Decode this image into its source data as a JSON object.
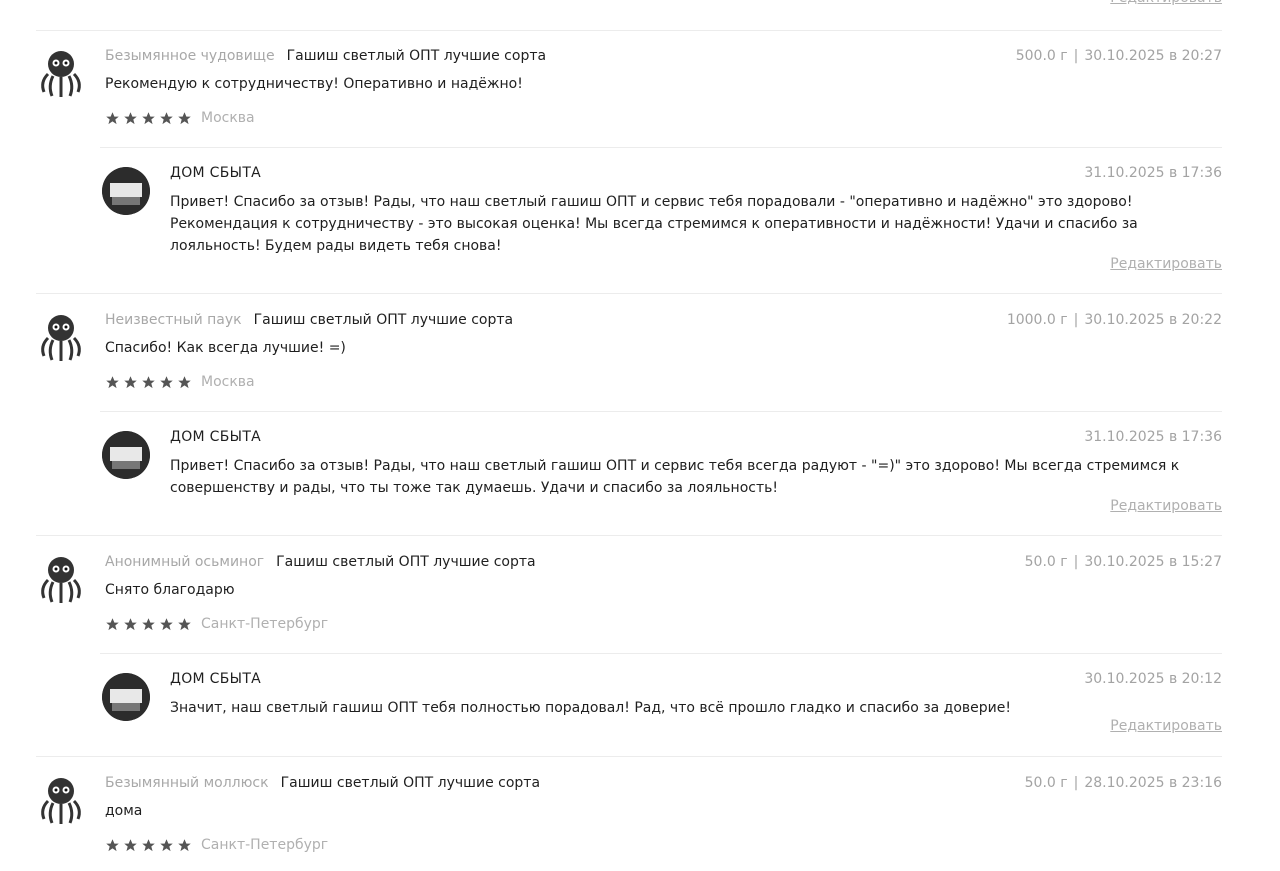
{
  "edit_label": "Редактировать",
  "reviews": [
    {
      "author": "Безымянное чудовище",
      "product": "Гашиш светлый ОПТ лучшие сорта",
      "weight": "500.0 г",
      "date": "30.10.2025 в 20:27",
      "text": "Рекомендую к сотрудничеству! Оперативно и надёжно!",
      "stars": 5,
      "city": "Москва",
      "reply": {
        "author": "ДОМ СБЫТА",
        "date": "31.10.2025 в 17:36",
        "text": "Привет! Спасибо за отзыв! Рады, что наш светлый гашиш ОПТ и сервис тебя порадовали - \"оперативно и надёжно\" это здорово! Рекомендация к сотрудничеству - это высокая оценка! Мы всегда стремимся к оперативности и надёжности! Удачи и спасибо за лояльность! Будем рады видеть тебя снова!"
      }
    },
    {
      "author": "Неизвестный паук",
      "product": "Гашиш светлый ОПТ лучшие сорта",
      "weight": "1000.0 г",
      "date": "30.10.2025 в 20:22",
      "text": "Спасибо! Как всегда лучшие! =)",
      "stars": 5,
      "city": "Москва",
      "reply": {
        "author": "ДОМ СБЫТА",
        "date": "31.10.2025 в 17:36",
        "text": "Привет! Спасибо за отзыв! Рады, что наш светлый гашиш ОПТ и сервис тебя всегда радуют - \"=)\" это здорово! Мы всегда стремимся к совершенству и рады, что ты тоже так думаешь. Удачи и спасибо за лояльность!"
      }
    },
    {
      "author": "Анонимный осьминог",
      "product": "Гашиш светлый ОПТ лучшие сорта",
      "weight": "50.0 г",
      "date": "30.10.2025 в 15:27",
      "text": "Снято благодарю",
      "stars": 5,
      "city": "Санкт-Петербург",
      "reply": {
        "author": "ДОМ СБЫТА",
        "date": "30.10.2025 в 20:12",
        "text": "Значит, наш светлый гашиш ОПТ тебя полностью порадовал! Рад, что всё прошло гладко и спасибо за доверие!"
      }
    },
    {
      "author": "Безымянный моллюск",
      "product": "Гашиш светлый ОПТ лучшие сорта",
      "weight": "50.0 г",
      "date": "28.10.2025 в 23:16",
      "text": "дома",
      "stars": 5,
      "city": "Санкт-Петербург"
    }
  ],
  "icons": {
    "user_avatar": "octopus-icon",
    "shop_avatar": "shop-logo-avatar",
    "star": "star-icon"
  },
  "colors": {
    "star": "#555555",
    "muted": "#a8a8a8"
  }
}
